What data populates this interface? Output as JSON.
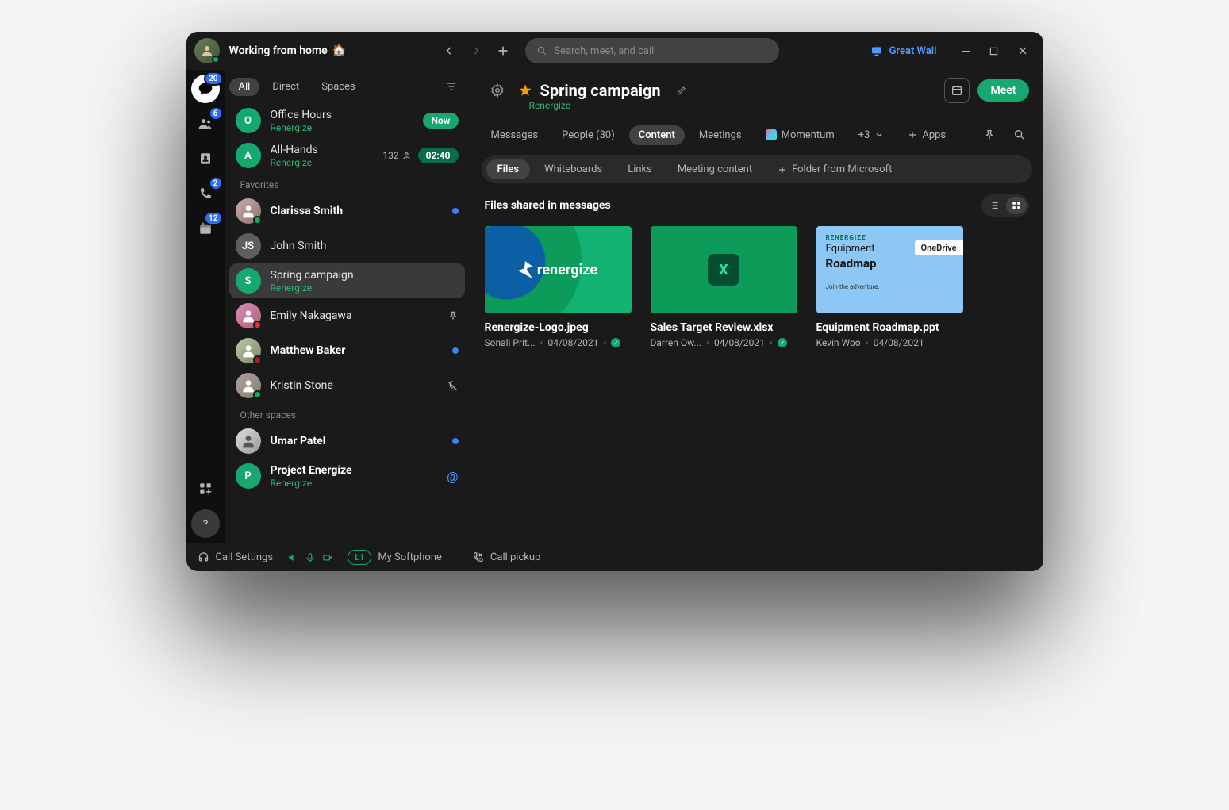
{
  "presence": {
    "status_text": "Working from home",
    "emoji": "🏠"
  },
  "search": {
    "placeholder": "Search, meet, and call"
  },
  "room": {
    "label": "Great Wall"
  },
  "rail": {
    "messaging_badge": "20",
    "teams_badge": "6",
    "calls_badge": "2",
    "calendar_badge": "12"
  },
  "filters": {
    "all": "All",
    "direct": "Direct",
    "spaces": "Spaces"
  },
  "sections": {
    "favorites": "Favorites",
    "other_spaces": "Other spaces"
  },
  "list": {
    "office_hours": {
      "title": "Office Hours",
      "org": "Renergize",
      "pill": "Now"
    },
    "all_hands": {
      "title": "All-Hands",
      "org": "Renergize",
      "count": "132",
      "time": "02:40"
    },
    "clarissa": {
      "title": "Clarissa Smith"
    },
    "john": {
      "title": "John Smith",
      "initials": "JS"
    },
    "spring": {
      "title": "Spring campaign",
      "org": "Renergize",
      "initial": "S"
    },
    "emily": {
      "title": "Emily Nakagawa"
    },
    "matthew": {
      "title": "Matthew Baker"
    },
    "kristin": {
      "title": "Kristin Stone"
    },
    "umar": {
      "title": "Umar Patel"
    },
    "project": {
      "title": "Project Energize",
      "org": "Renergize",
      "initial": "P"
    }
  },
  "space": {
    "title": "Spring campaign",
    "org": "Renergize",
    "meet": "Meet"
  },
  "tabs": {
    "messages": "Messages",
    "people": "People (30)",
    "content": "Content",
    "meetings": "Meetings",
    "momentum": "Momentum",
    "overflow": "+3",
    "apps": "Apps"
  },
  "subtabs": {
    "files": "Files",
    "whiteboards": "Whiteboards",
    "links": "Links",
    "meeting_content": "Meeting content",
    "add_folder": "Folder from Microsoft"
  },
  "files": {
    "heading": "Files shared in messages",
    "cards": [
      {
        "name": "Renergize-Logo.jpeg",
        "author": "Sonali Prit...",
        "date": "04/08/2021",
        "verified": true,
        "brand": "renergize"
      },
      {
        "name": "Sales Target Review.xlsx",
        "author": "Darren Ow...",
        "date": "04/08/2021",
        "verified": true,
        "xls_letter": "X"
      },
      {
        "name": "Equipment Roadmap.ppt",
        "author": "Kevin Woo",
        "date": "04/08/2021",
        "verified": false,
        "ppt": {
          "tag": "RENERGIZE",
          "line1": "Equipment",
          "line2": "Roadmap",
          "line3": "Join the adventure."
        },
        "chip": "OneDrive"
      }
    ]
  },
  "footer": {
    "call_settings": "Call Settings",
    "softphone_badge": "L1",
    "softphone": "My Softphone",
    "pickup": "Call pickup"
  }
}
